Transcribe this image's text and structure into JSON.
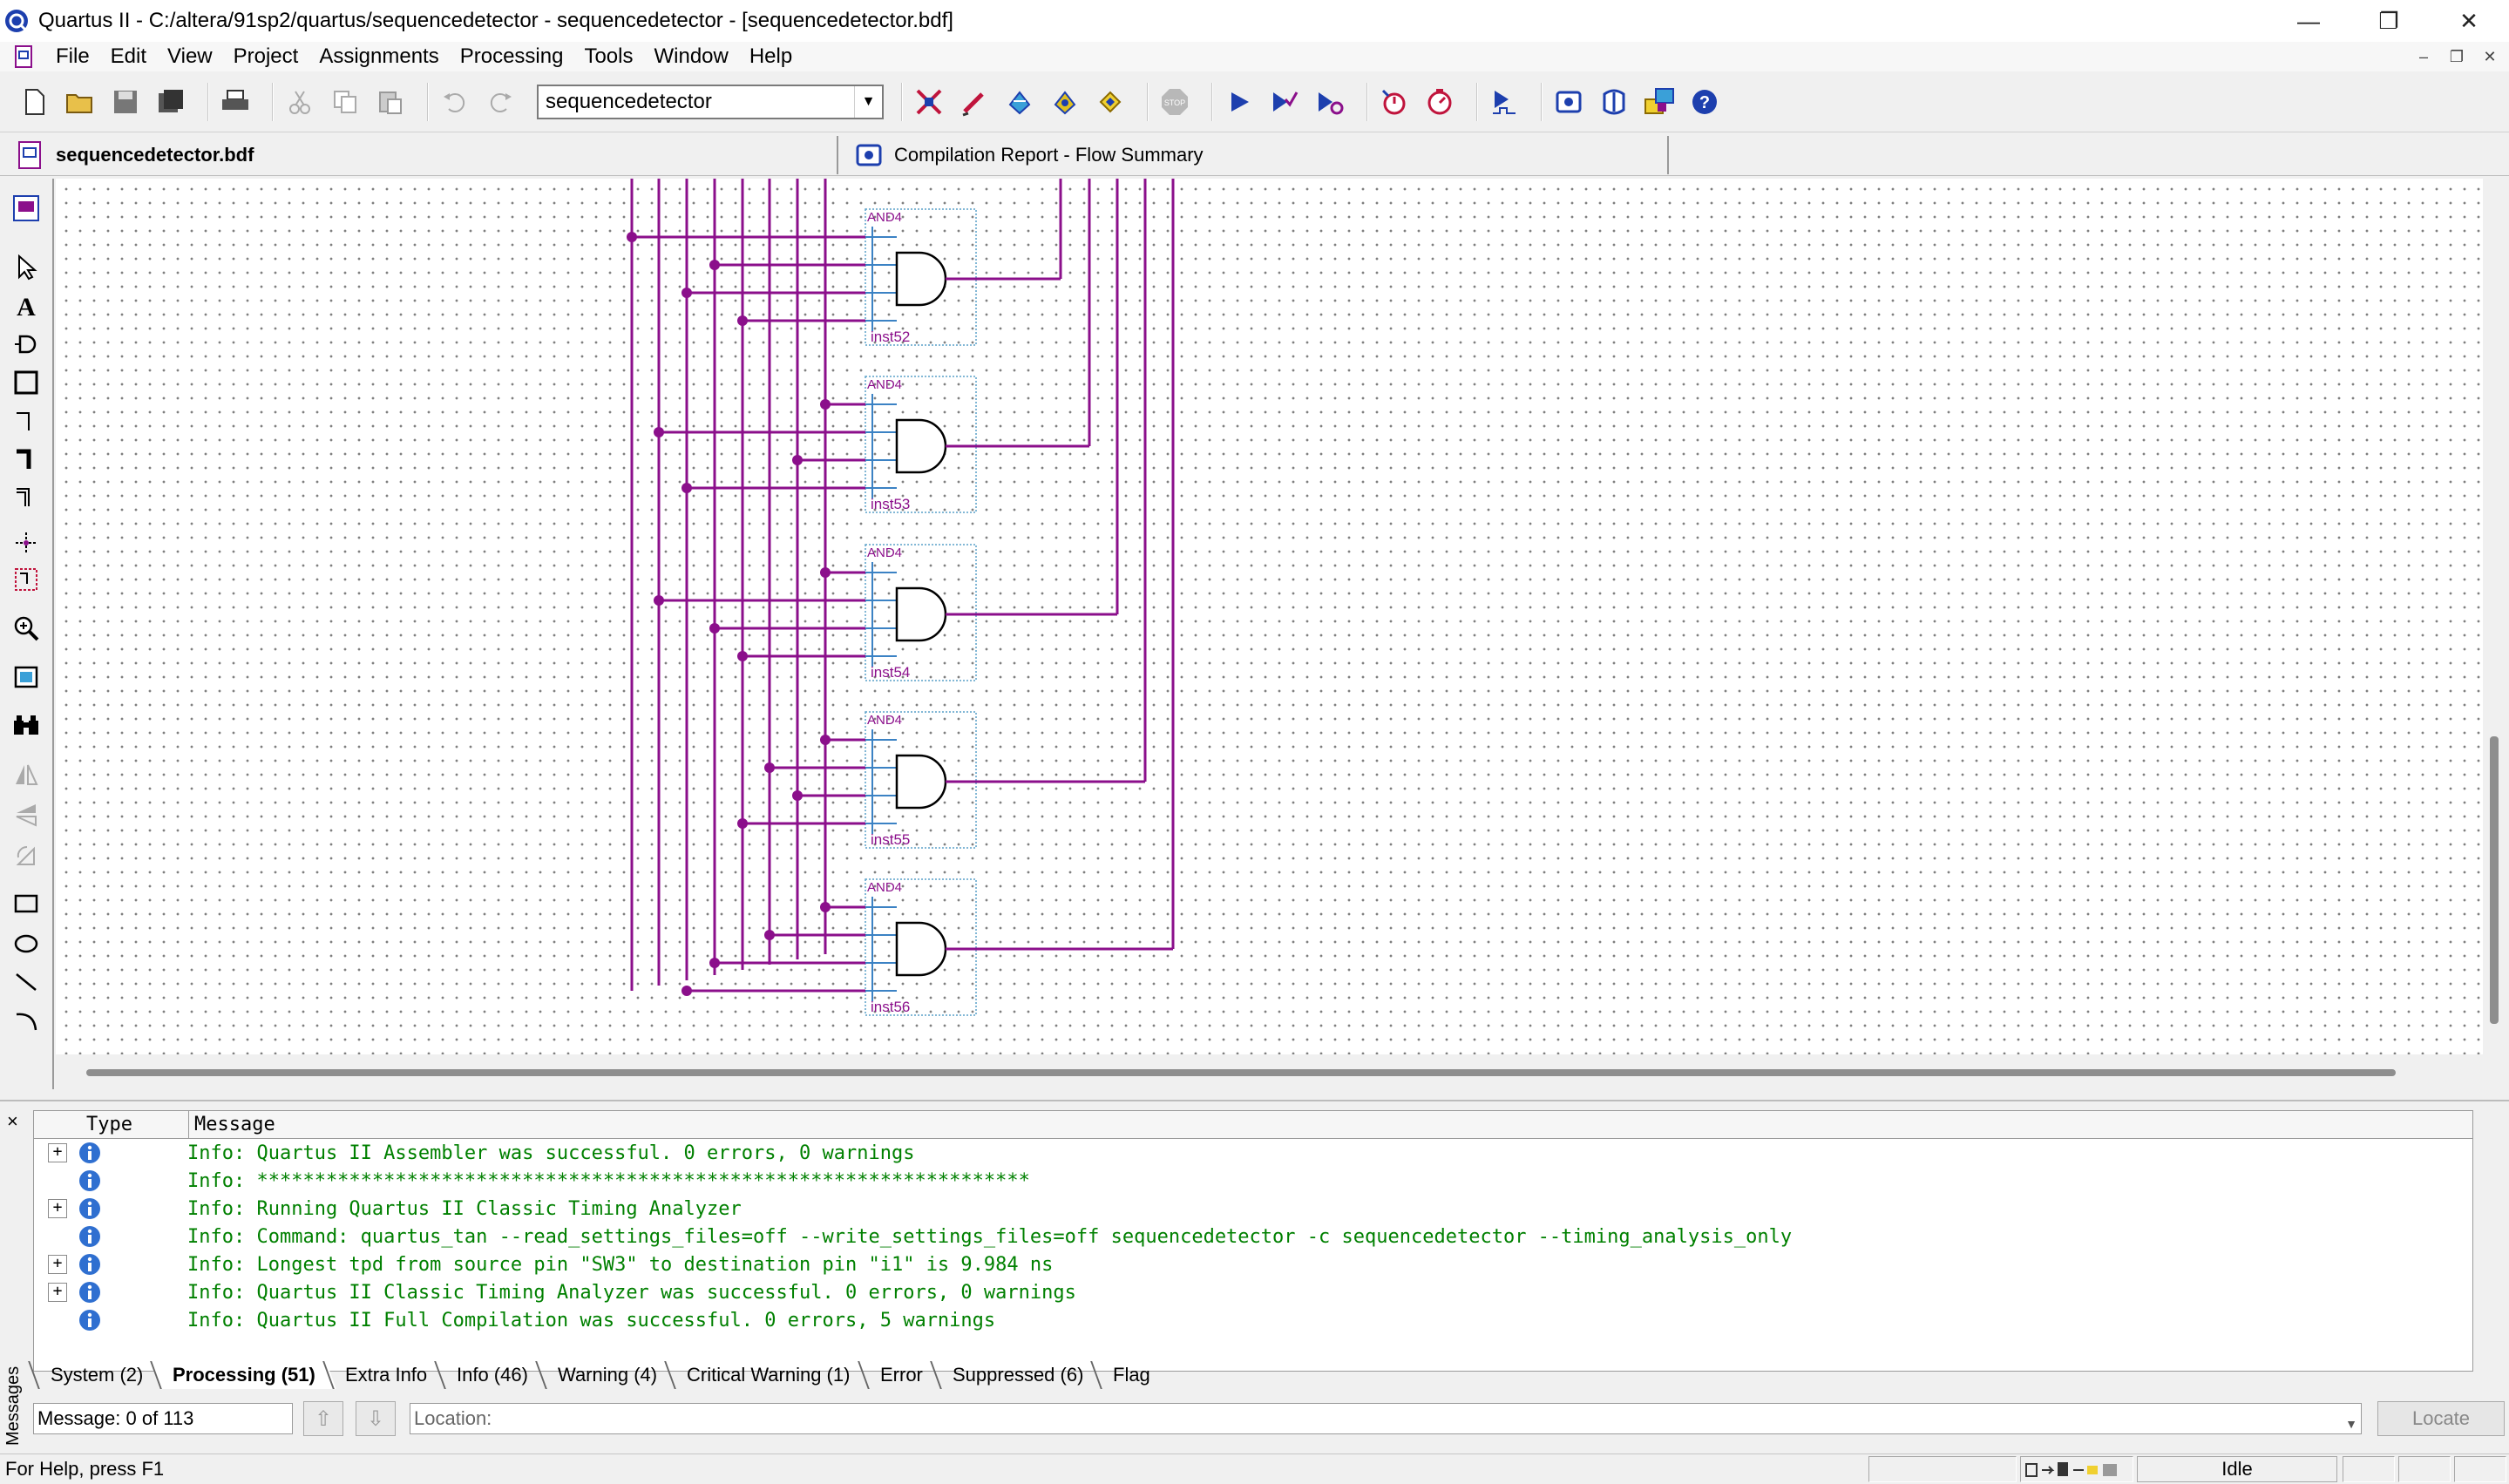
{
  "window": {
    "title": "Quartus II - C:/altera/91sp2/quartus/sequencedetector - sequencedetector - [sequencedetector.bdf]",
    "minimize": "—",
    "restore": "❐",
    "close": "✕"
  },
  "menu": [
    "File",
    "Edit",
    "View",
    "Project",
    "Assignments",
    "Processing",
    "Tools",
    "Window",
    "Help"
  ],
  "toolbar": {
    "project_combo_value": "sequencedetector"
  },
  "tabs": {
    "active": "sequencedetector.bdf",
    "inactive": "Compilation Report - Flow Summary"
  },
  "schematic": {
    "gate_type": "AND4",
    "instances": [
      "inst52",
      "inst53",
      "inst54",
      "inst55",
      "inst56"
    ],
    "wire_color": "#8b0f8b",
    "symbol_color": "#3b82c4"
  },
  "messages": {
    "header_type": "Type",
    "header_message": "Message",
    "rows": [
      {
        "expand": "+",
        "text": "Info: Quartus II Assembler was successful. 0 errors, 0 warnings"
      },
      {
        "expand": "",
        "text": "Info: *******************************************************************"
      },
      {
        "expand": "+",
        "text": "Info: Running Quartus II Classic Timing Analyzer"
      },
      {
        "expand": "",
        "text": "Info: Command: quartus_tan --read_settings_files=off --write_settings_files=off sequencedetector -c sequencedetector --timing_analysis_only"
      },
      {
        "expand": "+",
        "text": "Info: Longest tpd from source pin \"SW3\" to destination pin \"i1\" is 9.984 ns"
      },
      {
        "expand": "+",
        "text": "Info: Quartus II Classic Timing Analyzer was successful. 0 errors, 0 warnings"
      },
      {
        "expand": "",
        "text": "Info: Quartus II Full Compilation was successful. 0 errors, 5 warnings"
      }
    ],
    "tabs": [
      "System (2)",
      "Processing (51)",
      "Extra Info",
      "Info (46)",
      "Warning (4)",
      "Critical Warning (1)",
      "Error",
      "Suppressed (6)",
      "Flag"
    ],
    "active_tab": "Processing (51)",
    "side_label": "Messages",
    "close": "×",
    "count": "Message: 0 of 113",
    "location_label": "Location:",
    "locate_button": "Locate"
  },
  "status": {
    "help": "For Help, press F1",
    "state": "Idle"
  },
  "colors": {
    "info_text": "#008000",
    "info_icon": "#2f6fd0"
  }
}
